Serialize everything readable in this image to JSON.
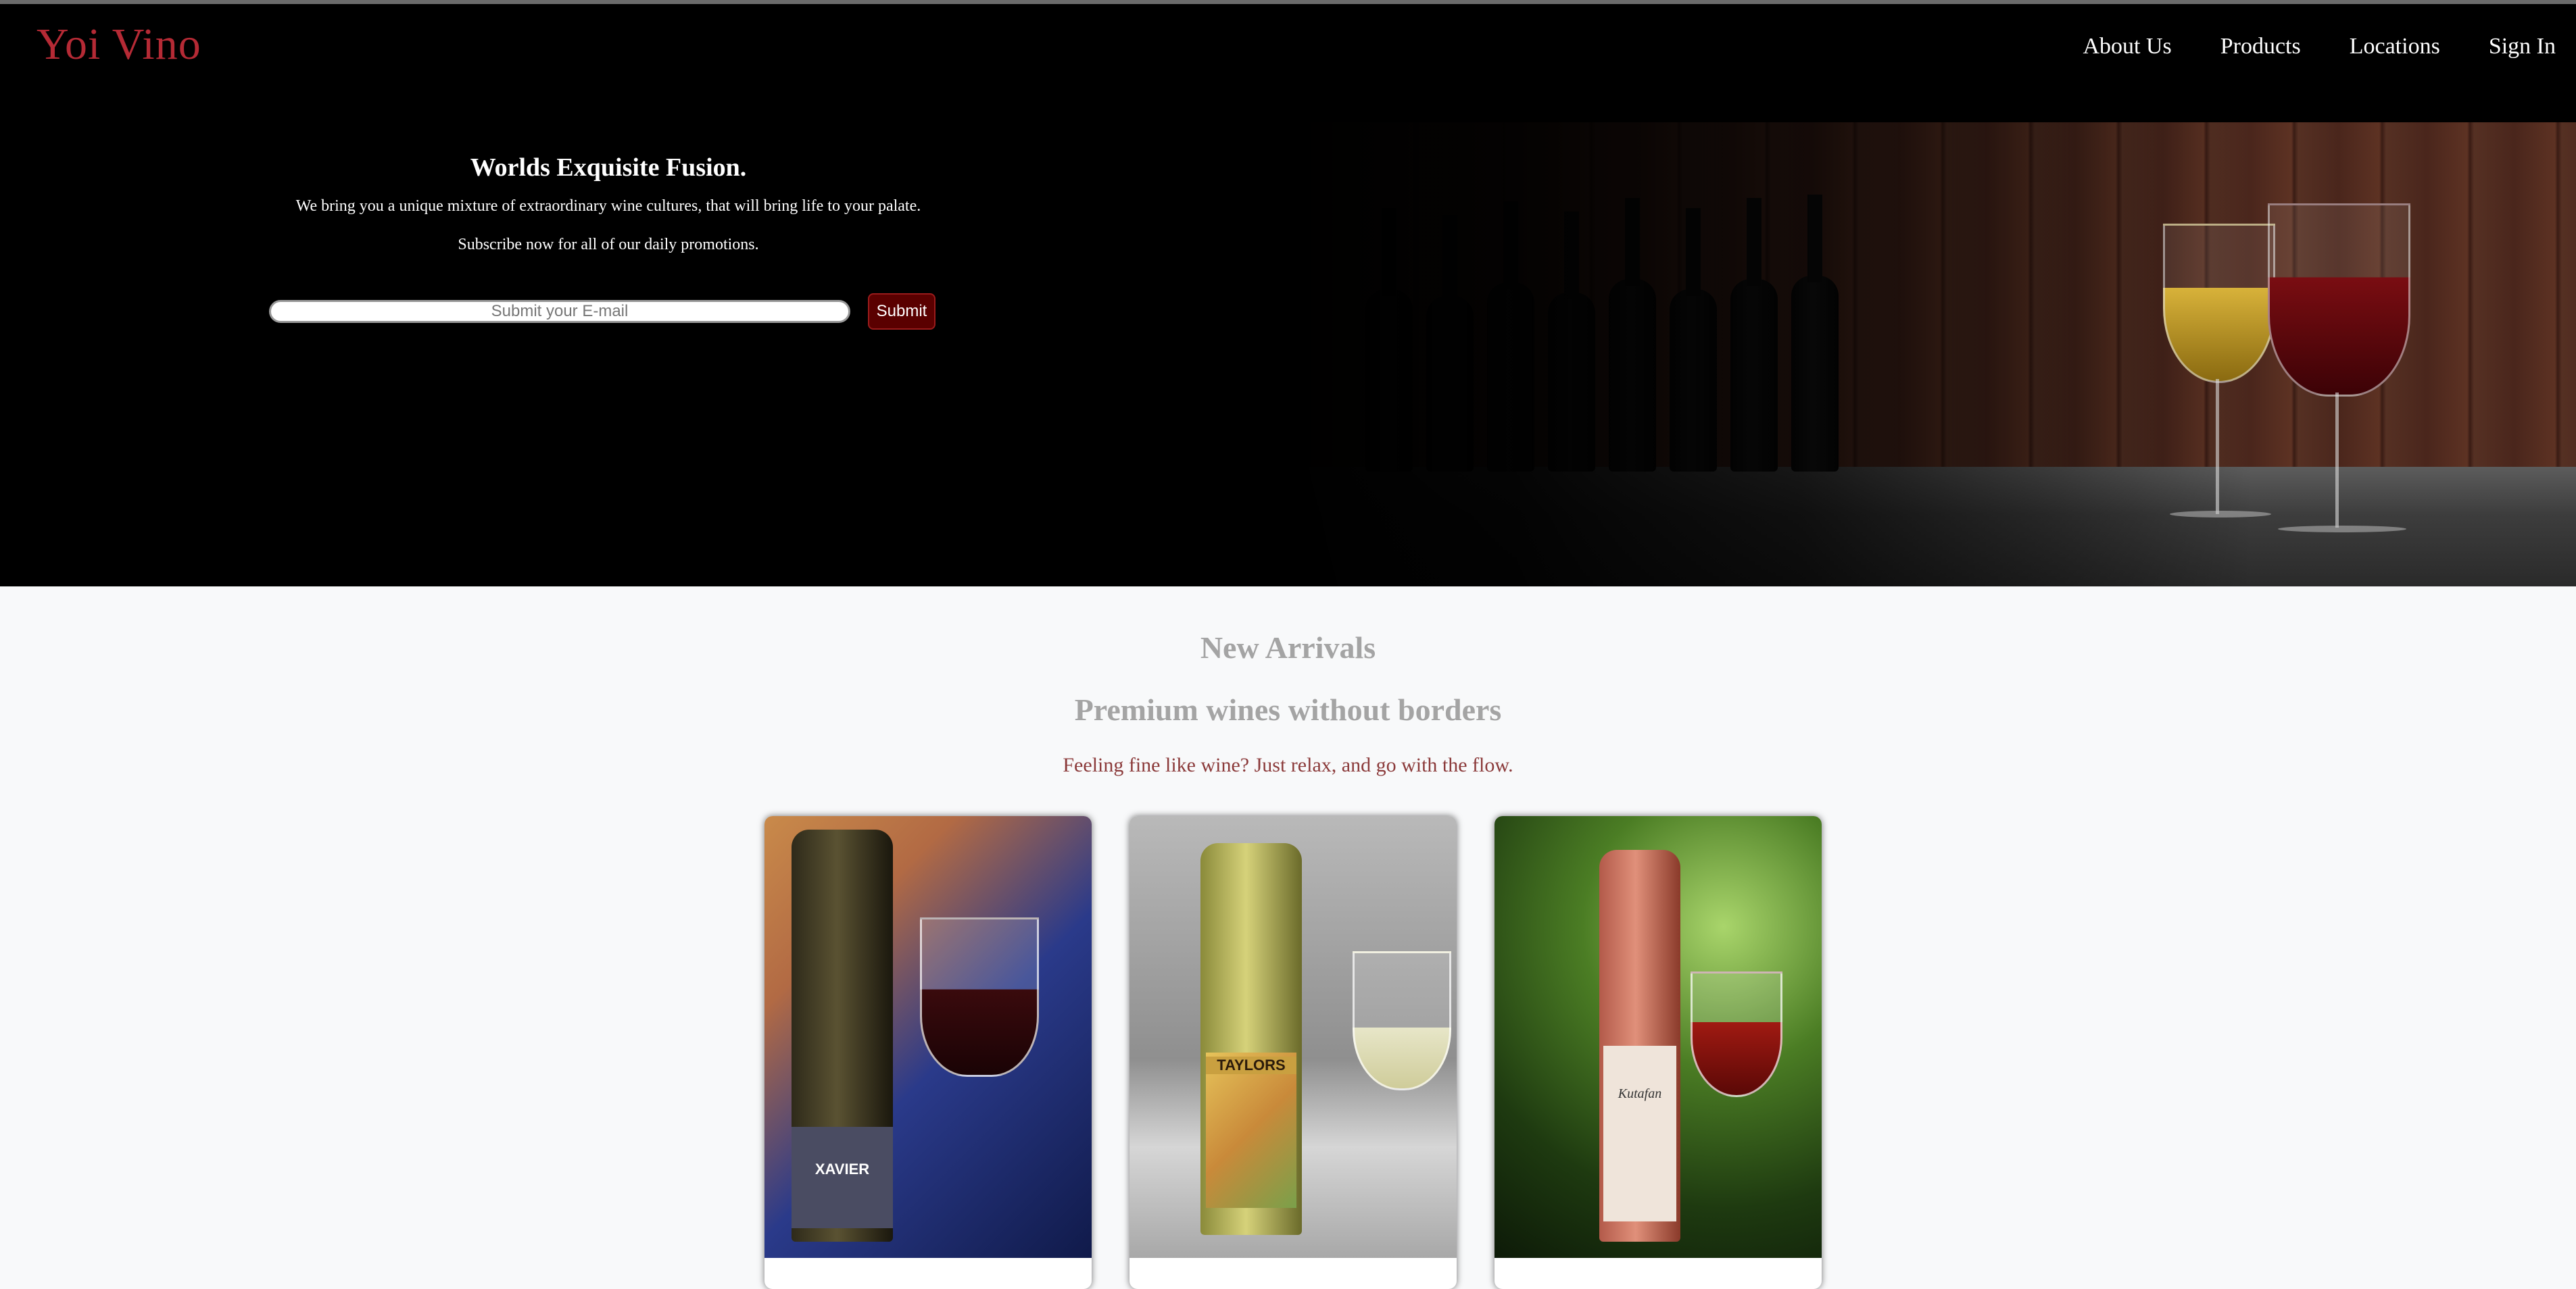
{
  "nav": {
    "logo": "Yoi Vino",
    "links": [
      "About Us",
      "Products",
      "Locations",
      "Sign In"
    ]
  },
  "hero": {
    "title": "Worlds Exquisite Fusion.",
    "line1": "We bring you a unique mixture of extraordinary wine cultures, that will bring life to your palate.",
    "line2": "Subscribe now for all of our daily promotions.",
    "email_placeholder": "Submit your E-mail",
    "submit_label": "Submit"
  },
  "arrivals": {
    "heading": "New Arrivals",
    "subheading": "Premium wines without borders",
    "tagline": "Feeling fine like wine? Just relax, and go with the flow.",
    "cards": [
      {
        "bottle_label": "XAVIER"
      },
      {
        "bottle_label": "TAYLORS"
      },
      {
        "bottle_label": "Kutafan"
      }
    ]
  },
  "colors": {
    "logo": "#b52a35",
    "submit_bg": "#5a0000",
    "tagline": "#8b3a3a",
    "heading_gray": "#a4a4a4"
  }
}
